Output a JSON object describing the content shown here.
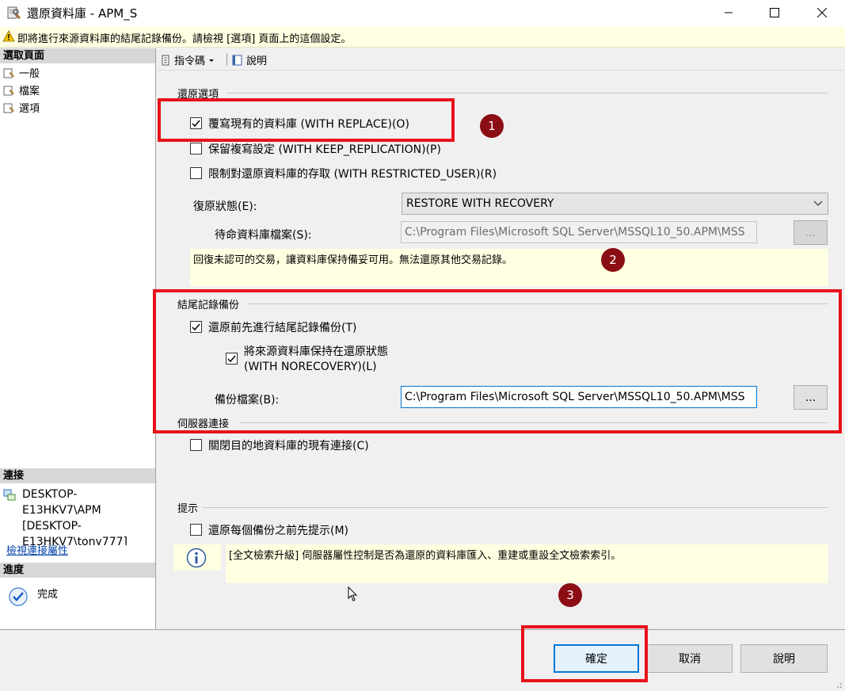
{
  "window": {
    "title": "還原資料庫 - APM_S"
  },
  "warning": {
    "text": "即將進行來源資料庫的結尾記錄備份。請檢視 [選項] 頁面上的這個設定。"
  },
  "left_panel": {
    "select_page_header": "選取頁面",
    "pages": [
      {
        "label": "一般",
        "icon": "page-wrench-icon"
      },
      {
        "label": "檔案",
        "icon": "page-wrench-icon"
      },
      {
        "label": "選項",
        "icon": "page-wrench-icon"
      }
    ],
    "connection_header": "連接",
    "connection_server": "DESKTOP-E13HKV7\\APM",
    "connection_user": "[DESKTOP-E13HKV7\\tony777]",
    "view_connection_link": "檢視連接屬性",
    "progress_header": "進度",
    "progress_status": "完成"
  },
  "toolbar": {
    "script_label": "指令碼",
    "help_label": "說明"
  },
  "restore_options": {
    "title": "還原選項",
    "overwrite": {
      "label": "覆寫現有的資料庫 (WITH REPLACE)(O)",
      "checked": true
    },
    "keep_replication": {
      "label": "保留複寫設定 (WITH KEEP_REPLICATION)(P)",
      "checked": false
    },
    "restricted_user": {
      "label": "限制對還原資料庫的存取 (WITH RESTRICTED_USER)(R)",
      "checked": false
    },
    "recovery_state_label": "復原狀態(E):",
    "recovery_state_value": "RESTORE WITH RECOVERY",
    "standby_file_label": "待命資料庫檔案(S):",
    "standby_file_value": "C:\\Program Files\\Microsoft SQL Server\\MSSQL10_50.APM\\MSS",
    "standby_browse": "...",
    "recovery_info": "回復未認可的交易，讓資料庫保持備妥可用。無法還原其他交易記錄。"
  },
  "tail_log": {
    "title": "結尾記錄備份",
    "take_tail_log": {
      "label": "還原前先進行結尾記錄備份(T)",
      "checked": true
    },
    "leave_norecovery_line1": "將來源資料庫保持在還原狀態",
    "leave_norecovery_line2": "(WITH NORECOVERY)(L)",
    "leave_norecovery_checked": true,
    "backup_file_label": "備份檔案(B):",
    "backup_file_value": "C:\\Program Files\\Microsoft SQL Server\\MSSQL10_50.APM\\MSS",
    "backup_browse": "..."
  },
  "server_connections": {
    "title": "伺服器連接",
    "close_existing": {
      "label": "關閉目的地資料庫的現有連接(C)",
      "checked": false
    }
  },
  "prompt": {
    "title": "提示",
    "prompt_before_each": {
      "label": "還原每個備份之前先提示(M)",
      "checked": false
    },
    "fulltext_info": "[全文檢索升級] 伺服器屬性控制是否為還原的資料庫匯入、重建或重設全文檢索索引。"
  },
  "annotations": {
    "marker1": "1",
    "marker2": "2",
    "marker3": "3",
    "box_color": "#e8111b",
    "marker_color": "#8b0e14"
  },
  "buttons": {
    "ok": "確定",
    "cancel": "取消",
    "help": "說明"
  }
}
